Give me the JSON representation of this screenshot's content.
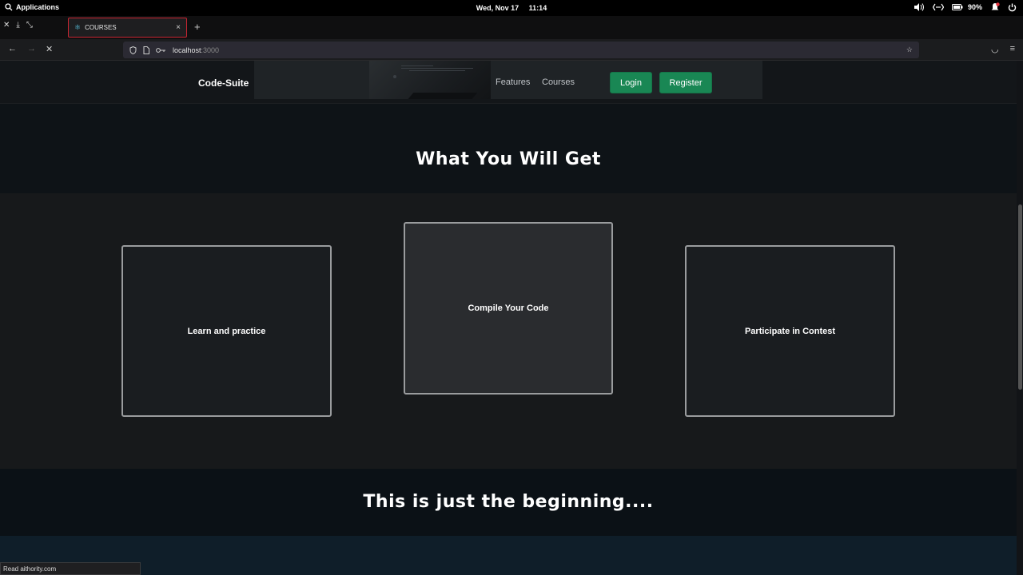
{
  "os": {
    "activities_label": "Applications",
    "date": "Wed, Nov 17",
    "time": "11:14",
    "battery": "90%",
    "icons": [
      "search-icon",
      "volume-icon",
      "network-icon",
      "battery-icon",
      "notification-icon",
      "power-icon"
    ]
  },
  "browser": {
    "tab_title": "COURSES",
    "url_host": "localhost",
    "url_port": ":3000",
    "status_text": "Read aithority.com",
    "accent": "#c72532"
  },
  "site": {
    "brand": "Code-Suite",
    "nav_links": [
      "Features",
      "Courses"
    ],
    "login_label": "Login",
    "register_label": "Register",
    "button_color": "#198754"
  },
  "main": {
    "section_title": "What You Will Get",
    "cards": [
      {
        "label": "Learn and practice"
      },
      {
        "label": "Compile Your Code"
      },
      {
        "label": "Participate in Contest"
      }
    ],
    "footer_heading": "This is just the beginning...."
  }
}
